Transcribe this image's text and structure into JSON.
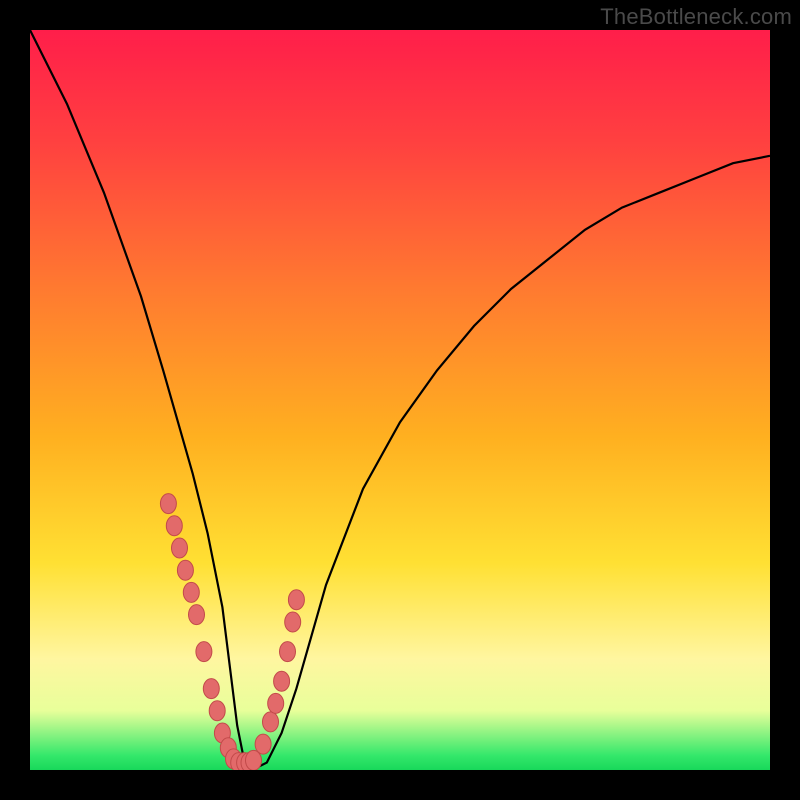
{
  "watermark": "TheBottleneck.com",
  "chart_data": {
    "type": "line",
    "title": "",
    "xlabel": "",
    "ylabel": "",
    "xlim": [
      0,
      100
    ],
    "ylim": [
      0,
      100
    ],
    "grid": false,
    "legend": false,
    "series": [
      {
        "name": "bottleneck-curve",
        "color": "#000000",
        "x": [
          0,
          5,
          10,
          15,
          18,
          20,
          22,
          24,
          26,
          27,
          28,
          29,
          30,
          32,
          34,
          36,
          38,
          40,
          45,
          50,
          55,
          60,
          65,
          70,
          75,
          80,
          85,
          90,
          95,
          100
        ],
        "y": [
          100,
          90,
          78,
          64,
          54,
          47,
          40,
          32,
          22,
          14,
          6,
          1,
          0,
          1,
          5,
          11,
          18,
          25,
          38,
          47,
          54,
          60,
          65,
          69,
          73,
          76,
          78,
          80,
          82,
          83
        ]
      }
    ],
    "markers": {
      "name": "data-points",
      "color": "#e26a6a",
      "outline": "#c24a4a",
      "x": [
        18.7,
        19.5,
        20.2,
        21.0,
        21.8,
        22.5,
        23.5,
        24.5,
        25.3,
        26.0,
        26.8,
        27.5,
        28.2,
        29.0,
        29.6,
        30.2,
        31.5,
        32.5,
        33.2,
        34.0,
        34.8,
        35.5,
        36.0
      ],
      "y": [
        36.0,
        33.0,
        30.0,
        27.0,
        24.0,
        21.0,
        16.0,
        11.0,
        8.0,
        5.0,
        3.0,
        1.5,
        1.0,
        1.0,
        1.0,
        1.3,
        3.5,
        6.5,
        9.0,
        12.0,
        16.0,
        20.0,
        23.0
      ]
    },
    "background_gradient_stops": [
      {
        "pos": 0,
        "color": "#ff1e4a"
      },
      {
        "pos": 15,
        "color": "#ff4040"
      },
      {
        "pos": 35,
        "color": "#ff7a30"
      },
      {
        "pos": 55,
        "color": "#ffb020"
      },
      {
        "pos": 72,
        "color": "#ffe033"
      },
      {
        "pos": 85,
        "color": "#fff6a0"
      },
      {
        "pos": 92,
        "color": "#e8ff9a"
      },
      {
        "pos": 98,
        "color": "#35e86b"
      },
      {
        "pos": 100,
        "color": "#18d85a"
      }
    ]
  }
}
